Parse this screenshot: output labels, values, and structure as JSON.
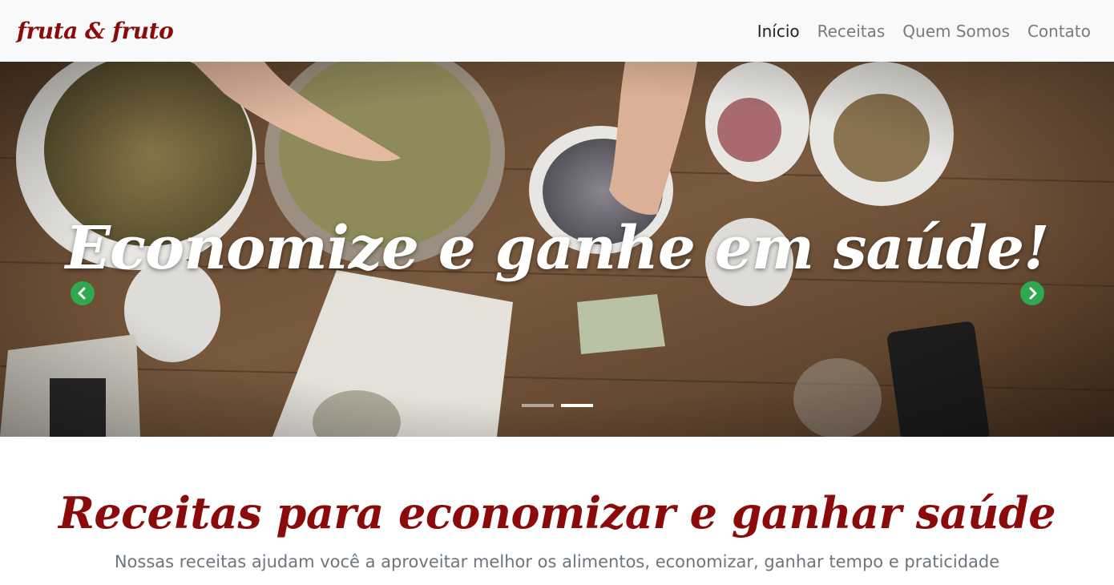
{
  "navbar": {
    "brand": "fruta & fruto",
    "links": [
      {
        "label": "Início",
        "active": true
      },
      {
        "label": "Receitas",
        "active": false
      },
      {
        "label": "Quem Somos",
        "active": false
      },
      {
        "label": "Contato",
        "active": false
      }
    ]
  },
  "hero": {
    "caption": "Economize e ganhe em saúde!",
    "prev_icon": "chevron-left-icon",
    "next_icon": "chevron-right-icon",
    "slide_count": 2,
    "active_slide": 2
  },
  "section": {
    "title": "Receitas para economizar e ganhar saúde",
    "subtitle": "Nossas receitas ajudam você a aproveitar melhor os alimentos, economizar, ganhar tempo e praticidade"
  },
  "colors": {
    "brand": "#8b0a0a",
    "navbar_bg": "#f8f9fa",
    "arrow": "#2fa84f",
    "muted": "#6c757d"
  }
}
